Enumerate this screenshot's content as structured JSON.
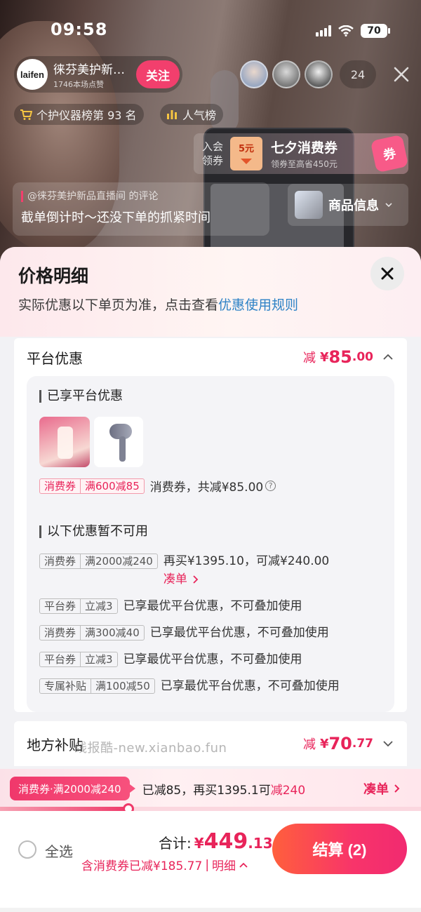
{
  "status_bar": {
    "time": "09:58",
    "battery": "70"
  },
  "live": {
    "host_avatar_text": "laifen",
    "host_name": "徕芬美护新…",
    "host_likes": "1746本场点赞",
    "follow_label": "关注",
    "viewer_count": "24",
    "rank_label": "个护仪器榜第 93 名",
    "popular_label": "人气榜",
    "coupon": {
      "claim_line1": "入会",
      "claim_line2": "领券",
      "ticket_value": "5元",
      "title": "七夕消费券",
      "subtitle": "领券至高省450元",
      "badge": "券"
    },
    "comment": {
      "source": "@徕芬美护新品直播间 的评论",
      "text": "截单倒计时～还没下单的抓紧时间"
    },
    "product_info_label": "商品信息"
  },
  "sheet": {
    "title": "价格明细",
    "subtitle_prefix": "实际优惠以下单页为准，点击查看",
    "subtitle_link": "优惠使用规则",
    "platform": {
      "title": "平台优惠",
      "minus": "减",
      "yen": "¥",
      "int": "85",
      "dec": ".00",
      "enjoyed_title": "已享平台优惠",
      "enjoyed_coupon": {
        "type": "消费券",
        "rule": "满600减85",
        "desc": "消费券，共减¥85.00"
      },
      "unavailable_title": "以下优惠暂不可用",
      "unavailable": [
        {
          "type": "消费券",
          "rule": "满2000减240",
          "desc": "再买¥1395.10，可减¥240.00",
          "link": "凑单"
        },
        {
          "type": "平台券",
          "rule": "立减3",
          "desc": "已享最优平台优惠，不可叠加使用"
        },
        {
          "type": "消费券",
          "rule": "满300减40",
          "desc": "已享最优平台优惠，不可叠加使用"
        },
        {
          "type": "平台券",
          "rule": "立减3",
          "desc": "已享最优平台优惠，不可叠加使用"
        },
        {
          "type": "专属补贴",
          "rule": "满100减50",
          "desc": "已享最优平台优惠，不可叠加使用"
        }
      ]
    },
    "local": {
      "title": "地方补贴",
      "minus": "减",
      "yen": "¥",
      "int": "70",
      "dec": ".77"
    },
    "watermark": "线报酷-new.xianbao.fun"
  },
  "promo_strip": {
    "tag": "消费券·满2000减240",
    "text_prefix": "已减85，再买1395.1可",
    "text_highlight": "减240",
    "link": "凑单",
    "progress_fraction": 0.305
  },
  "checkout": {
    "select_all": "全选",
    "total_label": "合计:",
    "total_yen": "¥",
    "total_int": "449",
    "total_dec": ".13",
    "saved_text": "含消费券已减¥185.77",
    "detail_link": "明细",
    "pay_label": "结算 (2)"
  },
  "colors": {
    "accent": "#e8245a",
    "link": "#2d82c6"
  }
}
